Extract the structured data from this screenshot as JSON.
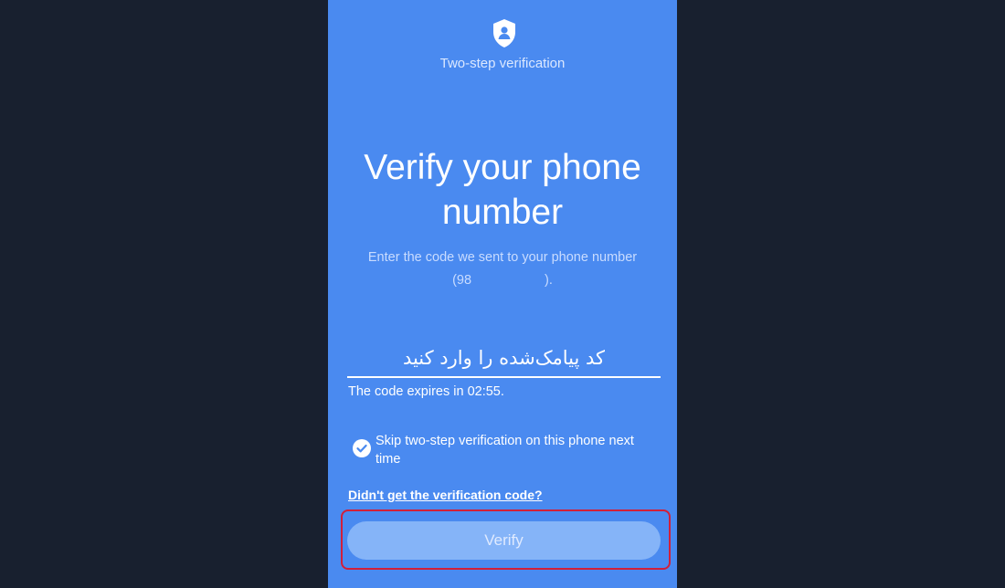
{
  "header": {
    "label": "Two-step verification",
    "icon": "shield-user-icon"
  },
  "main": {
    "title": "Verify your phone number",
    "subtitle_line1": "Enter the code we sent to your phone number",
    "phone_prefix": "(98",
    "phone_suffix": ")."
  },
  "code_input": {
    "placeholder": "کد پیامک‌شده را وارد کنید",
    "value": ""
  },
  "expiry": {
    "text": "The code expires in 02:55."
  },
  "skip": {
    "label": "Skip two-step verification on this phone next time",
    "checked": true,
    "icon": "check-circle-icon"
  },
  "resend": {
    "label": "Didn't get the verification code?"
  },
  "verify_button": {
    "label": "Verify"
  },
  "colors": {
    "background": "#18202f",
    "panel": "#4a8af0",
    "button": "#85b4f8",
    "highlight": "#d11f3a"
  }
}
